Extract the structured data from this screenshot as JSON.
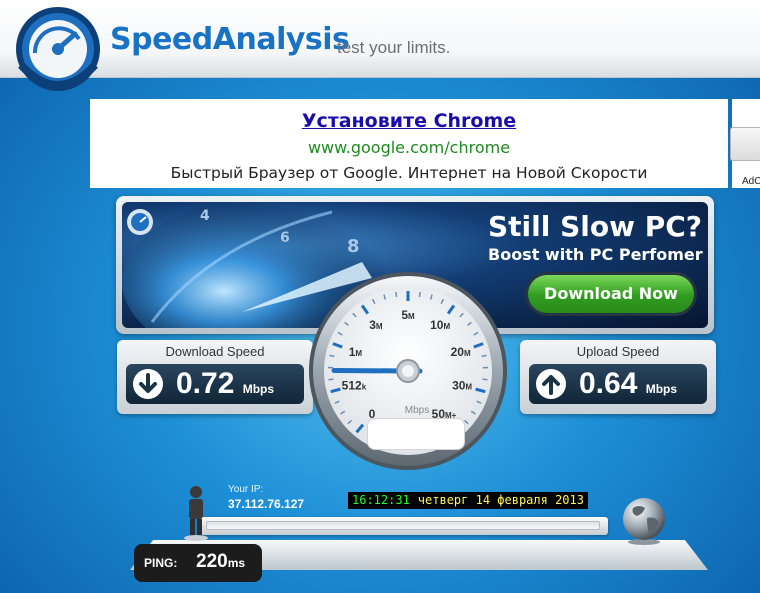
{
  "header": {
    "brand": "SpeedAnalysis",
    "tagline": "test your limits.",
    "logo_icon": "speedometer-logo-icon"
  },
  "ad": {
    "title": "Установите Chrome",
    "url": "www.google.com/chrome",
    "description": "Быстрый Браузер от Google. Интернет на Новой Скорости",
    "side_label": "AdC"
  },
  "banner": {
    "title": "Still Slow PC?",
    "subtitle": "Boost with PC Perfomer",
    "button": "Download Now",
    "dial_numbers": [
      "4",
      "6",
      "8"
    ]
  },
  "download": {
    "label": "Download Speed",
    "value": "0.72",
    "unit": "Mbps",
    "icon": "arrow-down-icon"
  },
  "upload": {
    "label": "Upload Speed",
    "value": "0.64",
    "unit": "Mbps",
    "icon": "arrow-up-icon"
  },
  "gauge": {
    "unit": "Mbps",
    "ticks": [
      {
        "num": "0",
        "unit": ""
      },
      {
        "num": "512",
        "unit": "k"
      },
      {
        "num": "1",
        "unit": "M"
      },
      {
        "num": "3",
        "unit": "M"
      },
      {
        "num": "5",
        "unit": "M"
      },
      {
        "num": "10",
        "unit": "M"
      },
      {
        "num": "20",
        "unit": "M"
      },
      {
        "num": "30",
        "unit": "M"
      },
      {
        "num": "50",
        "unit": "M+"
      }
    ],
    "needle_value_mbps": 0.72
  },
  "status": {
    "ip_label": "Your IP:",
    "ip": "37.112.76.127",
    "time": "16:12:31",
    "date": "четверг 14 февраля 2013"
  },
  "ping": {
    "label": "PING:",
    "value": "220",
    "unit": "ms"
  },
  "colors": {
    "brand": "#1a72c4",
    "button_green": "#2f9c1f",
    "clock_time": "#1bff2e",
    "clock_date": "#fff65a"
  }
}
